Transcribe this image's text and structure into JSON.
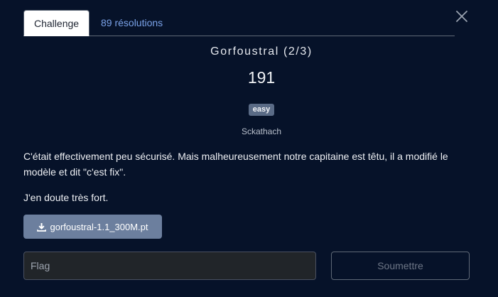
{
  "tabs": {
    "challenge_label": "Challenge",
    "solves_label": "89 résolutions"
  },
  "challenge": {
    "name": "Gorfoustral (2/3)",
    "points": "191",
    "difficulty": "easy",
    "author": "Sckathach",
    "description_1": "C'était effectivement peu sécurisé. Mais malheureusement notre capitaine est têtu, il a modifié le modèle et dit \"c'est fix\".",
    "description_2": "J'en doute très fort."
  },
  "file": {
    "label": "gorfoustral-1.1_300M.pt",
    "icon": "download-icon"
  },
  "form": {
    "flag_placeholder": "Flag",
    "flag_value": "",
    "submit_label": "Soumettre"
  },
  "colors": {
    "background": "#061229",
    "accent_link": "#7aa2e8",
    "badge": "#5a6b86",
    "file_button": "#6c7f9e"
  }
}
